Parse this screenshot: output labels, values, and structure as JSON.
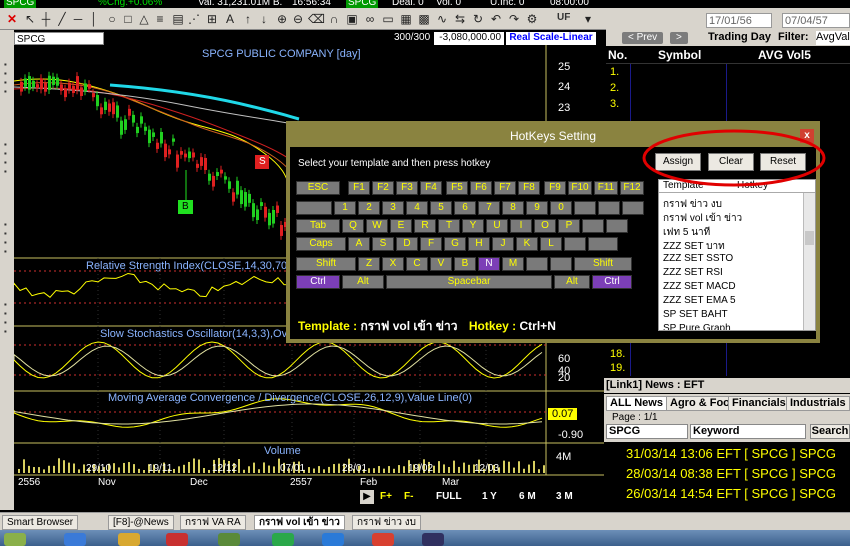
{
  "topbar": {
    "badge1": "SPCG",
    "change": "%Chg.+0.06%",
    "value": "Val. 31,231.01M B.",
    "time": "16:56:34",
    "badge2": "SPCG",
    "deal": "Deal. 0",
    "vol": "Vol. 0",
    "uinc": "U.Inc. 0",
    "clock": "08:00:00"
  },
  "toolbar": {
    "uf_label": "UF"
  },
  "chart": {
    "symbol": "SPCG",
    "count": "300/300",
    "value": "-3,080,000.00",
    "scale": "Real Scale-Linear",
    "title": "SPCG PUBLIC COMPANY [day]",
    "price_ticks": [
      "25",
      "24",
      "23"
    ],
    "signal_s": "S",
    "signal_b": "B",
    "rsi_title": "Relative Strength Index(CLOSE,14,30,70)",
    "stoch_title": "Slow Stochastics Oscillator(14,3,3),Ov",
    "stoch_ticks": [
      "60",
      "40",
      "20"
    ],
    "macd_title": "Moving Average Convergence / Divergence(CLOSE,26,12,9),Value Line(0)",
    "macd_value": "0.07",
    "macd_tick": "-0.90",
    "volume_title": "Volume",
    "volume_tick": "4M",
    "x_dates": [
      "29/10",
      "19/11",
      "12/12",
      "07/01",
      "28/01",
      "19/02",
      "12/03"
    ],
    "x_months": [
      "2556",
      "Nov",
      "Dec",
      "2557",
      "Feb",
      "Mar"
    ]
  },
  "nav": {
    "full": "FULL",
    "y1": "1 Y",
    "m6": "6 M",
    "m3": "3 M",
    "fplus": "F+",
    "fminus": "F-"
  },
  "right": {
    "date_from": "17/01/56",
    "date_to": "07/04/57",
    "prev": "< Prev",
    "next": ">",
    "trading_day": "Trading Day",
    "filter": "Filter:",
    "filter_value": "AvgVal",
    "col_no": "No.",
    "col_symbol": "Symbol",
    "col_avg": "AVG Vol5",
    "rank_numbers": [
      "1.",
      "2.",
      "3.",
      "18.",
      "19."
    ]
  },
  "news": {
    "title": "[Link1] News : EFT",
    "tabs": [
      "ALL News",
      "Agro & Food",
      "Financials",
      "Industrials"
    ],
    "page": "Page : 1/1",
    "symbol_value": "SPCG",
    "keyword_value": "Keyword",
    "search": "Search",
    "items": [
      "31/03/14 13:06  EFT  [ SPCG ]  SPCG",
      "28/03/14 08:38  EFT  [ SPCG ]  SPCG",
      "26/03/14 14:54  EFT  [ SPCG ]  SPCG"
    ]
  },
  "bottom_tabs": [
    "Smart Browser",
    "[F8]-@News",
    "กราฟ VA RA",
    "กราฟ vol เข้า ข่าว",
    "กราฟ ข่าว งบ"
  ],
  "dialog": {
    "title": "HotKeys Setting",
    "hint": "Select your template and then press hotkey",
    "assign": "Assign",
    "clear": "Clear",
    "reset": "Reset",
    "close": "x",
    "col_template": "Template",
    "col_hotkey": "Hotkey",
    "keyboard": {
      "row1": [
        "ESC",
        "F1",
        "F2",
        "F3",
        "F4",
        "F5",
        "F6",
        "F7",
        "F8",
        "F9",
        "F10",
        "F11",
        "F12"
      ],
      "row2": [
        "1",
        "2",
        "3",
        "4",
        "5",
        "6",
        "7",
        "8",
        "9",
        "0"
      ],
      "row3": [
        "Tab",
        "Q",
        "W",
        "E",
        "R",
        "T",
        "Y",
        "U",
        "I",
        "O",
        "P"
      ],
      "row4": [
        "Caps",
        "A",
        "S",
        "D",
        "F",
        "G",
        "H",
        "J",
        "K",
        "L"
      ],
      "row5": [
        "Shift",
        "Z",
        "X",
        "C",
        "V",
        "B",
        "N",
        "M",
        "Shift"
      ],
      "row6": [
        "Ctrl",
        "Alt",
        "Spacebar",
        "Alt",
        "Ctrl"
      ]
    },
    "templates": [
      "กราฟ ข่าว งบ",
      "กราฟ vol เข้า ข่าว",
      "เฟท 5 นาที",
      "ZZZ SET บาท",
      "ZZZ SET SSTO",
      "ZZZ SET RSI",
      "ZZZ SET MACD",
      "ZZZ SET EMA 5",
      "SP SET BAHT",
      "SP Pure Graph"
    ],
    "footer_template_label": "Template :",
    "footer_template_value": "กราฟ vol เข้า ข่าว",
    "footer_hotkey_label": "Hotkey :",
    "footer_hotkey_value": "Ctrl+N"
  },
  "colors": {
    "dialog_frame": "#8a8340",
    "key_selected": "#7c3fb7",
    "annotation": "#e00000",
    "news_text": "#ffff00"
  }
}
